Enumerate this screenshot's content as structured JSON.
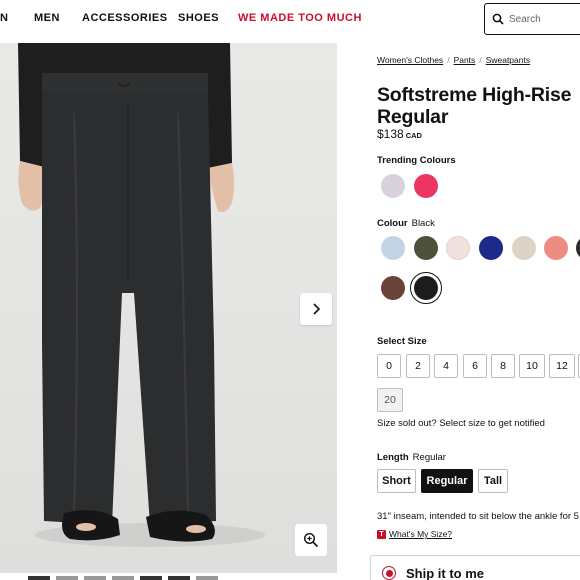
{
  "nav": {
    "items": [
      "N",
      "MEN",
      "ACCESSORIES",
      "SHOES",
      "WE MADE TOO MUCH"
    ],
    "search_placeholder": "Search"
  },
  "breadcrumb": [
    "Women's Clothes",
    "Pants",
    "Sweatpants"
  ],
  "product": {
    "title_line1": "Softstreme High-Rise",
    "title_line2": "Regular",
    "price": "$138",
    "currency": "CAD"
  },
  "trending": {
    "label": "Trending Colours",
    "colors": [
      "#d9d2dd",
      "#ec3563"
    ]
  },
  "colour": {
    "label": "Colour",
    "selected": "Black",
    "swatches": [
      "#c5d3e6",
      "#4d5139",
      "#f1e2de",
      "#1e2a8a",
      "#ddd3c5",
      "#eb8c80",
      "#2b2b2b",
      "#6b4438",
      "#1c1c1c"
    ],
    "selected_color": "#1c1c1c"
  },
  "size": {
    "label": "Select Size",
    "options": [
      "0",
      "2",
      "4",
      "6",
      "8",
      "10",
      "12"
    ],
    "soldout_option": "20",
    "sold_out_note": "Size sold out? Select size to get notified"
  },
  "length": {
    "label": "Length",
    "selected": "Regular",
    "options": [
      "Short",
      "Regular",
      "Tall"
    ]
  },
  "inseam_text": "31\" inseam, intended to sit below the ankle for 5",
  "size_help": {
    "icon": "T",
    "link": "What's My Size?"
  },
  "shipping": {
    "label": "Ship it to me"
  },
  "colors": {
    "accent": "#c8102e",
    "text": "#111111"
  }
}
